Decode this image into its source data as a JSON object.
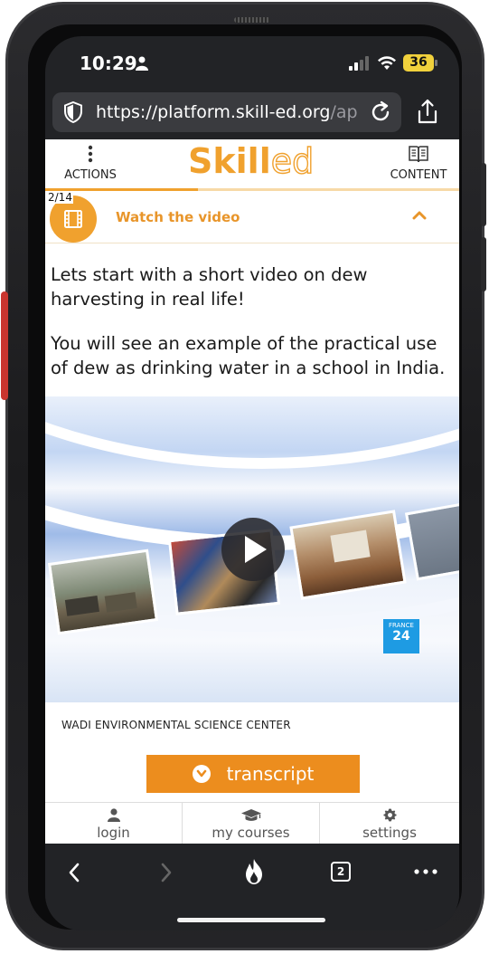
{
  "status_bar": {
    "time": "10:29",
    "battery": "36"
  },
  "browser": {
    "url_host": "https://platform.skill-ed.org",
    "url_path": "/app...",
    "tab_count": "2"
  },
  "site": {
    "actions_label": "ACTIONS",
    "logo_main": "Skill",
    "logo_ed": "ed",
    "content_label": "CONTENT",
    "progress_fraction": 0.37
  },
  "section": {
    "count": "2/14",
    "title": "Watch the video"
  },
  "body": {
    "paragraph_1": "Lets start with a short video on dew harvesting in real life!",
    "paragraph_2": "You will see an example of the practical use of dew as drinking water in a school in India."
  },
  "video": {
    "watermark_top": "FRANCE",
    "watermark_num": "24",
    "caption": "WADI ENVIRONMENTAL SCIENCE CENTER"
  },
  "transcript_button": "transcript",
  "bottom_nav": {
    "login": "login",
    "my_courses": "my courses",
    "settings": "settings"
  },
  "colors": {
    "brand_orange": "#f0a12e",
    "button_orange": "#ec8d1e"
  }
}
